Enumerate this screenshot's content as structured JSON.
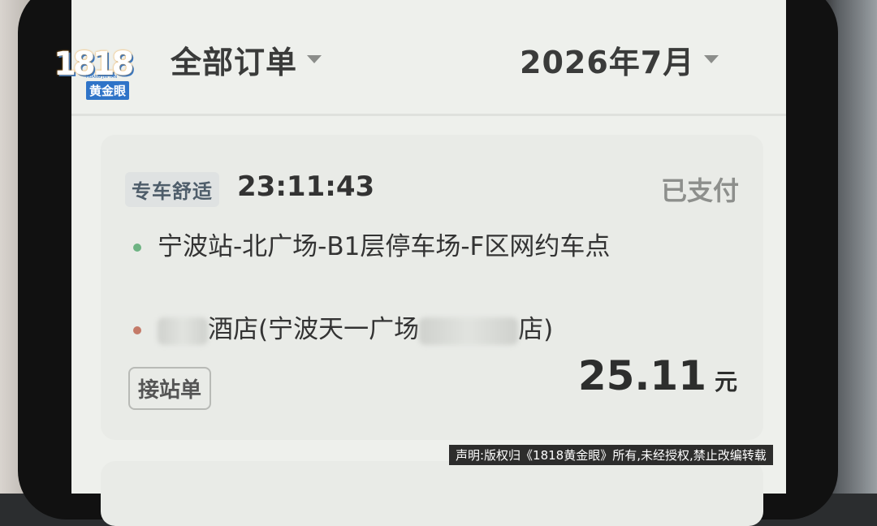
{
  "header": {
    "order_filter": "全部订单",
    "month_filter": "2026年7月"
  },
  "order": {
    "badge": "专车舒适",
    "time": "23:11:43",
    "status": "已支付",
    "start_address": "宁波站-北广场-B1层停车场-F区网约车点",
    "end_address_part1": "酒店(宁波天一广场",
    "end_address_part2": "店)",
    "tag": "接站单",
    "amount": "25.11",
    "unit": "元"
  },
  "logo": {
    "digits": "1818",
    "sub": "黄金眼",
    "tiny": "HUANG JIN YAN"
  },
  "watermark": "声明:版权归《1818黄金眼》所有,未经授权,禁止改编转载",
  "colors": {
    "start_dot": "#6eb383",
    "end_dot": "#c47a68",
    "brand_blue": "#2f74c8"
  }
}
